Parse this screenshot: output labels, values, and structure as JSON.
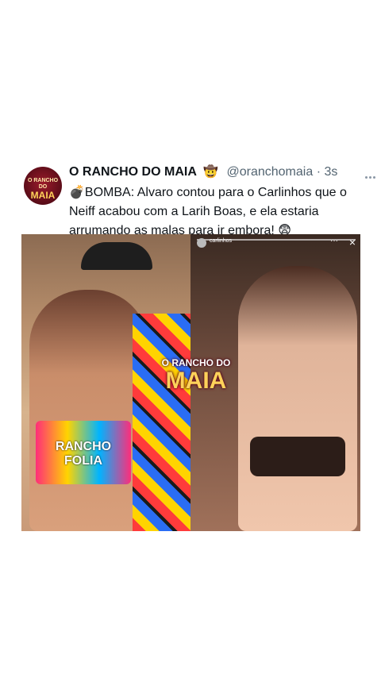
{
  "tweet": {
    "display_name": "O RANCHO DO MAIA",
    "name_emoji": "🤠",
    "handle": "@oranchomaia",
    "separator": "·",
    "time": "3s",
    "text_emoji": "💣",
    "text": "BOMBA: Alvaro contou para o Carlinhos que o Neiff acabou com a Larih Boas, e ela estaria arrumando as malas para ir embora! 😨",
    "avatar_logo_top": "O RANCHO DO",
    "avatar_logo_big": "MAIA"
  },
  "media": {
    "watermark_top": "O RANCHO DO",
    "watermark_big": "MAIA",
    "left_shirt_text": "RANCHO FOLIA",
    "story_user": "carlinhos",
    "story_close": "×",
    "story_menu": "···"
  },
  "icons": {
    "more": "more-horizontal-icon"
  }
}
